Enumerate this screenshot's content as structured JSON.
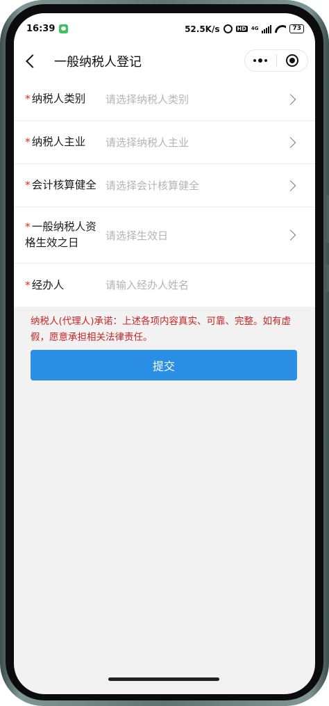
{
  "status_bar": {
    "time": "16:39",
    "net_speed": "52.5K/s",
    "hd_label": "HD",
    "network_type": "4G",
    "battery": "73"
  },
  "nav": {
    "title": "一般纳税人登记"
  },
  "form": {
    "rows": [
      {
        "label": "纳税人类别",
        "placeholder": "请选择纳税人类别"
      },
      {
        "label": "纳税人主业",
        "placeholder": "请选择纳税人主业"
      },
      {
        "label": "会计核算健全",
        "placeholder": "请选择会计核算健全"
      },
      {
        "label": "一般纳税人资格生效之日",
        "placeholder": "请选择生效日"
      },
      {
        "label": "经办人",
        "placeholder": "请输入经办人姓名"
      }
    ],
    "required_mark": "*"
  },
  "notice": "纳税人(代理人)承诺：上述各项内容真实、可靠、完整。如有虚假，愿意承担相关法律责任。",
  "submit_label": "提交",
  "colors": {
    "accent": "#2a8fe4",
    "notice_red": "#c62525",
    "required_red": "#d9312a",
    "wechat_green": "#3cc35f"
  }
}
